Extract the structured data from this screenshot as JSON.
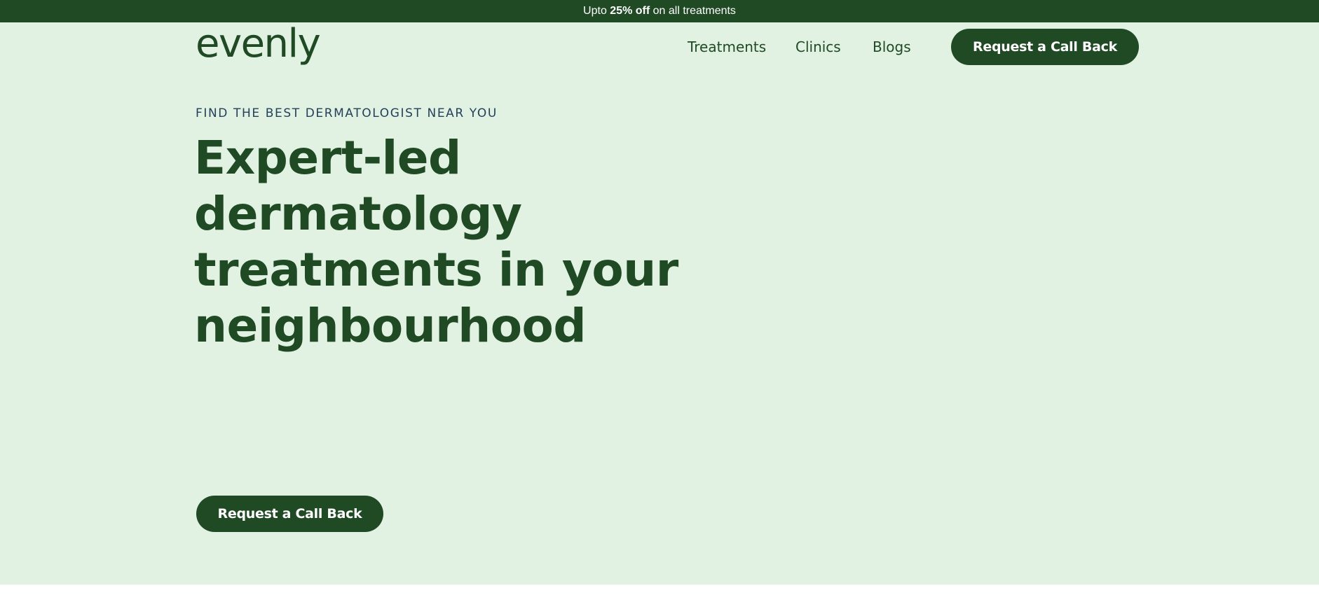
{
  "promo": {
    "prefix": "Upto ",
    "highlight": "25% off",
    "suffix": " on all treatments"
  },
  "header": {
    "logo_text": "evenly",
    "nav": [
      {
        "label": "Treatments"
      },
      {
        "label": "Clinics"
      },
      {
        "label": "Blogs"
      }
    ],
    "cta_label": "Request a Call Back"
  },
  "hero": {
    "eyebrow": "FIND THE BEST DERMATOLOGIST NEAR YOU",
    "headline_lines": [
      "Expert-led",
      "dermatology",
      "treatments in your",
      "neighbourhood"
    ],
    "cta_label": "Request a Call Back"
  },
  "colors": {
    "brand_green": "#1f4a24",
    "hero_background": "#e1f2e2",
    "eyebrow_text": "#24405a"
  }
}
